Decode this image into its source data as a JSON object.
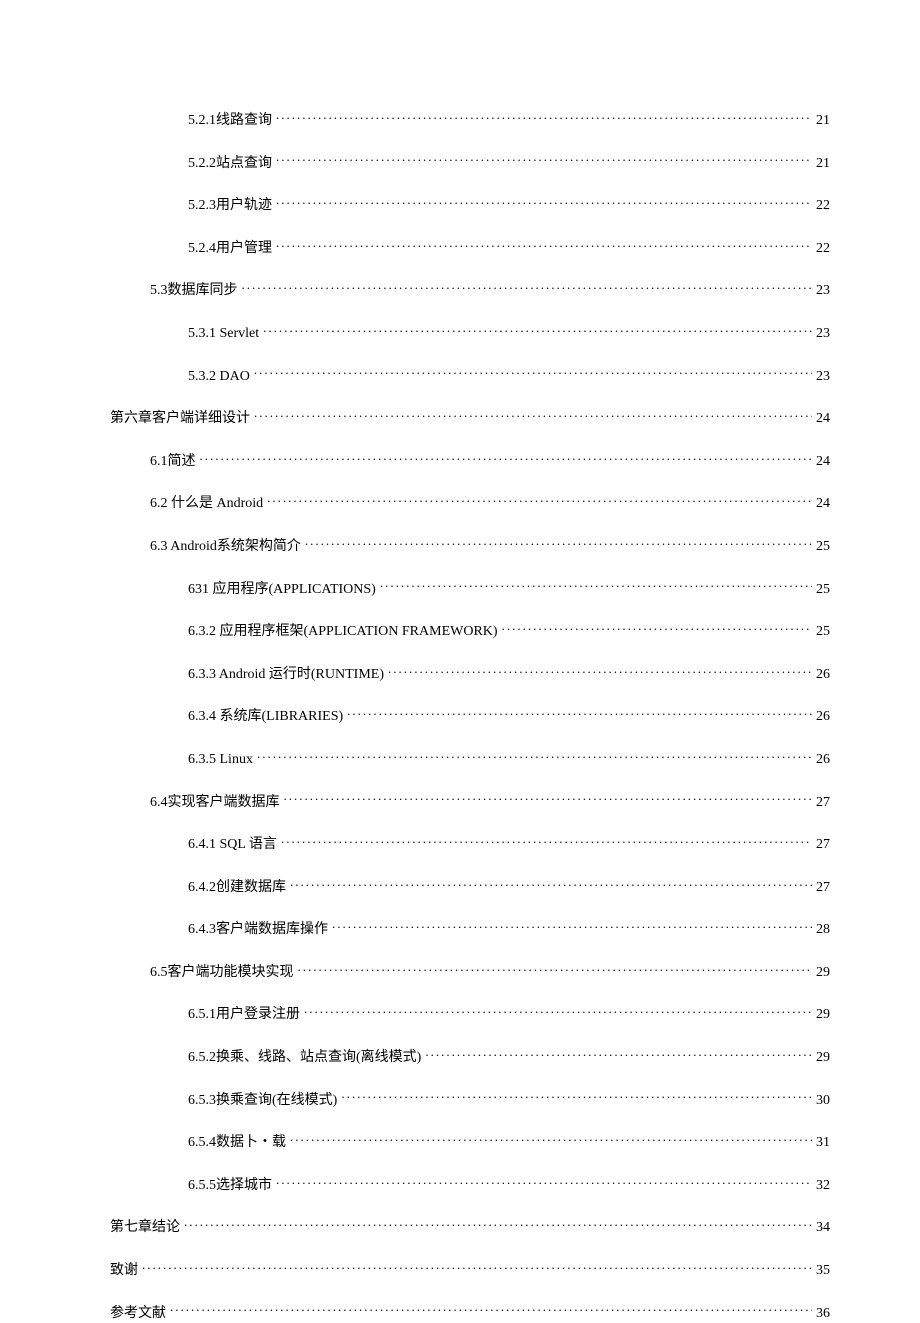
{
  "toc": [
    {
      "level": 2,
      "label": "5.2.1线路查询",
      "page": "21",
      "first": true
    },
    {
      "level": 2,
      "label": "5.2.2站点查询",
      "page": "21"
    },
    {
      "level": 2,
      "label": "5.2.3用户轨迹",
      "page": "22"
    },
    {
      "level": 2,
      "label": "5.2.4用户管理",
      "page": "22"
    },
    {
      "level": 1,
      "label": "5.3数据库同步",
      "page": "23"
    },
    {
      "level": 2,
      "label": "5.3.1  Servlet",
      "page": "23"
    },
    {
      "level": 2,
      "label": "5.3.2  DAO",
      "page": "23"
    },
    {
      "level": 0,
      "label": "第六章客户端详细设计",
      "page": "24"
    },
    {
      "level": 1,
      "label": "6.1简述",
      "page": "24"
    },
    {
      "level": 1,
      "label": "6.2  什么是  Android",
      "page": "24"
    },
    {
      "level": 1,
      "label": "6.3  Android系统架构简介",
      "page": "25"
    },
    {
      "level": 2,
      "label": "631 应用程序(APPLICATIONS)",
      "page": "25"
    },
    {
      "level": 2,
      "label": "6.3.2  应用程序框架(APPLICATION FRAMEWORK)",
      "page": "25"
    },
    {
      "level": 2,
      "label": "6.3.3  Android 运行时(RUNTIME)",
      "page": "26"
    },
    {
      "level": 2,
      "label": "6.3.4  系统库(LIBRARIES)",
      "page": "26"
    },
    {
      "level": 2,
      "label": "6.3.5  Linux",
      "page": "26"
    },
    {
      "level": 1,
      "label": "6.4实现客户端数据库",
      "page": "27"
    },
    {
      "level": 2,
      "label": "6.4.1 SQL 语言",
      "page": "27"
    },
    {
      "level": 2,
      "label": "6.4.2创建数据库",
      "page": "27"
    },
    {
      "level": 2,
      "label": "6.4.3客户端数据库操作",
      "page": "28"
    },
    {
      "level": 1,
      "label": "6.5客户端功能模块实现",
      "page": "29"
    },
    {
      "level": 2,
      "label": "6.5.1用户登录注册",
      "page": "29"
    },
    {
      "level": 2,
      "label": "6.5.2换乘、线路、站点查询(离线模式)",
      "page": "29"
    },
    {
      "level": 2,
      "label": "6.5.3换乘查询(在线模式)",
      "page": "30"
    },
    {
      "level": 2,
      "label": "6.5.4数据卜・载",
      "page": "31"
    },
    {
      "level": 2,
      "label": "6.5.5选择城市",
      "page": "32"
    },
    {
      "level": 0,
      "label": "第七章结论",
      "page": "34"
    },
    {
      "level": 0,
      "label": "致谢",
      "page": "35"
    },
    {
      "level": 0,
      "label": "参考文献",
      "page": "36"
    }
  ]
}
